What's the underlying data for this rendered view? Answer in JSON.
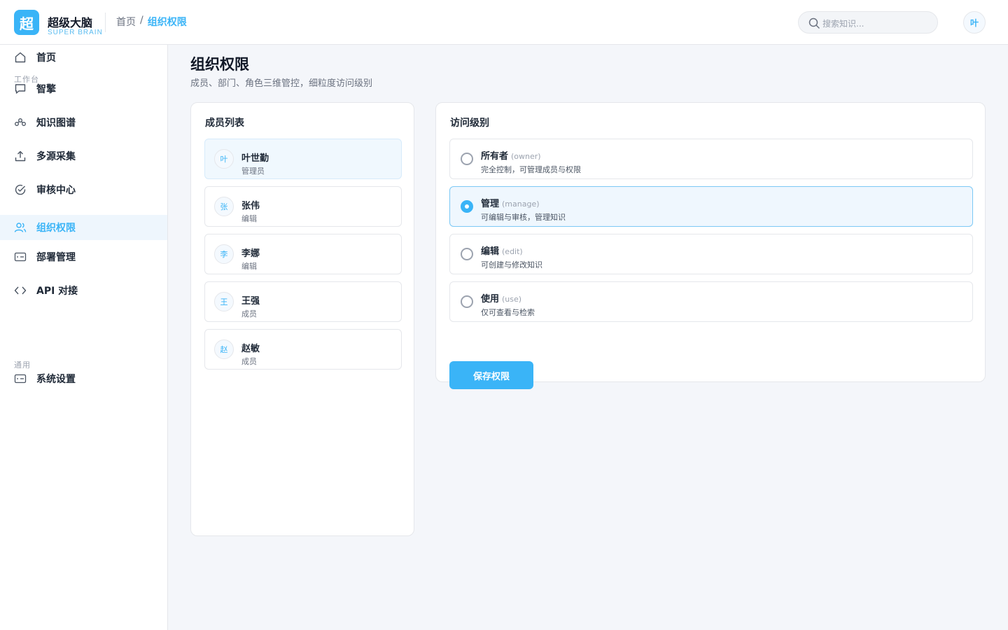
{
  "brand": {
    "logo_char": "超",
    "title": "超级大脑",
    "subtitle": "SUPER BRAIN"
  },
  "breadcrumb": {
    "home": "首页",
    "separator": "/",
    "current": "组织权限"
  },
  "search": {
    "placeholder": "搜索知识..."
  },
  "user": {
    "avatar_char": "叶"
  },
  "sidebar": {
    "section_workspace": "工作台",
    "section_general": "通用",
    "items": [
      {
        "label": "首页",
        "icon": "home-icon"
      },
      {
        "label": "智擎",
        "icon": "chat-bubble-icon"
      },
      {
        "label": "知识图谱",
        "icon": "graph-nodes-icon"
      },
      {
        "label": "多源采集",
        "icon": "upload-icon"
      },
      {
        "label": "审核中心",
        "icon": "check-circle-icon"
      },
      {
        "label": "组织权限",
        "icon": "users-icon",
        "active": true
      },
      {
        "label": "部署管理",
        "icon": "server-card-icon"
      },
      {
        "label": "API 对接",
        "icon": "code-brackets-icon"
      },
      {
        "label": "系统设置",
        "icon": "settings-card-icon"
      }
    ]
  },
  "page": {
    "title": "组织权限",
    "subtitle": "成员、部门、角色三维管控，细粒度访问级别"
  },
  "members_panel": {
    "title": "成员列表",
    "members": [
      {
        "avatar": "叶",
        "name": "叶世勤",
        "role": "管理员",
        "selected": true
      },
      {
        "avatar": "张",
        "name": "张伟",
        "role": "编辑"
      },
      {
        "avatar": "李",
        "name": "李娜",
        "role": "编辑"
      },
      {
        "avatar": "王",
        "name": "王强",
        "role": "成员"
      },
      {
        "avatar": "赵",
        "name": "赵敏",
        "role": "成员"
      }
    ]
  },
  "access_panel": {
    "title": "访问级别",
    "levels": [
      {
        "name": "所有者",
        "code": "(owner)",
        "desc": "完全控制，可管理成员与权限"
      },
      {
        "name": "管理",
        "code": "(manage)",
        "desc": "可编辑与审核，管理知识",
        "selected": true
      },
      {
        "name": "编辑",
        "code": "(edit)",
        "desc": "可创建与修改知识"
      },
      {
        "name": "使用",
        "code": "(use)",
        "desc": "仅可查看与检索"
      }
    ],
    "save_label": "保存权限"
  },
  "colors": {
    "accent": "#3ab4f7",
    "background": "#f4f6fa"
  }
}
